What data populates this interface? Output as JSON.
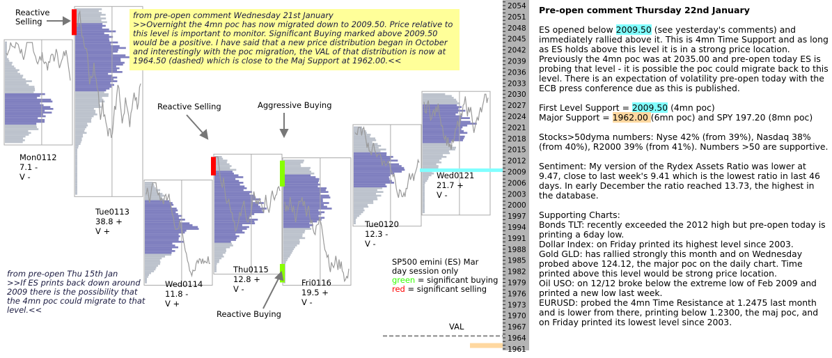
{
  "chart_data": {
    "type": "market-profile",
    "instrument_note": [
      "SP500 emini  (ES)  Mar",
      "day session only"
    ],
    "legend": [
      {
        "word": "green",
        "rest": " = significant buying",
        "color": "#33ff00"
      },
      {
        "word": "red",
        "rest": " = significant selling",
        "color": "#ff0000"
      }
    ],
    "y_axis": {
      "min": 1961,
      "max": 2054,
      "step": 3,
      "ticks": [
        2054,
        2051,
        2048,
        2045,
        2042,
        2039,
        2036,
        2033,
        2030,
        2027,
        2024,
        2021,
        2018,
        2015,
        2012,
        2009,
        2006,
        2003,
        2000,
        1997,
        1994,
        1991,
        1988,
        1985,
        1982,
        1979,
        1976,
        1973,
        1970,
        1967,
        1964,
        1961
      ]
    },
    "sessions": [
      {
        "day": "Mon0112",
        "range": "7.1 -",
        "value": "V -",
        "high": 2044,
        "low": 2017,
        "va_high": 2030,
        "va_low": 2022
      },
      {
        "day": "Tue0113",
        "range": "38.8 +",
        "value": "V +",
        "high": 2053,
        "low": 2003,
        "va_high": 2049,
        "va_low": 2031
      },
      {
        "day": "Wed0114",
        "range": "11.8 -",
        "value": "V +",
        "high": 2006,
        "low": 1979,
        "va_high": 2001,
        "va_low": 1987
      },
      {
        "day": "Thu0115",
        "range": "12.8 +",
        "value": "V -",
        "high": 2013,
        "low": 1982,
        "va_high": 2009,
        "va_low": 1990
      },
      {
        "day": "Fri0116",
        "range": "19.5 +",
        "value": "V -",
        "high": 2012,
        "low": 1979,
        "va_high": 2008,
        "va_low": 1994
      },
      {
        "day": "Tue0120",
        "range": "12.3 -",
        "value": "V -",
        "high": 2021,
        "low": 1995,
        "va_high": 2014,
        "va_low": 2005
      },
      {
        "day": "Wed0121",
        "range": "21.7 +",
        "value": "V -",
        "high": 2030,
        "low": 1998,
        "va_high": 2027,
        "va_low": 2017
      }
    ],
    "markers": [
      {
        "session": "Tue0113",
        "type": "selling",
        "color": "#ff0000",
        "from": 2046,
        "to": 2053
      },
      {
        "session": "Thu0115",
        "type": "selling",
        "color": "#ff0000",
        "from": 2008,
        "to": 2013
      },
      {
        "session": "Fri0116",
        "type": "buying",
        "color": "#88ff00",
        "from": 2005,
        "to": 2012
      },
      {
        "session": "Fri0116",
        "type": "buying",
        "color": "#88ff00",
        "from": 1979,
        "to": 1984
      }
    ],
    "levels": [
      {
        "label": "",
        "price": 2009.5,
        "color": "#80ffff",
        "style": "band"
      },
      {
        "label": "VAL",
        "price": 1964.5,
        "color": "#888888",
        "style": "dashed"
      },
      {
        "label": "",
        "price": 1962.0,
        "color": "#ffd8a0",
        "style": "band"
      }
    ],
    "annotations": [
      {
        "text": "Reactive Selling",
        "lines": [
          "Reactive",
          "Selling"
        ]
      },
      {
        "text": "Reactive Selling"
      },
      {
        "text": "Aggressive Buying"
      },
      {
        "text": "Reactive Buying"
      }
    ]
  },
  "notes": {
    "yellow": "from pre-open comment Wednesday 21st January\n>>Overnight the 4mn poc has now migrated down to 2009.50.  Price relative to this level is important to monitor.  Significant Buying marked above 2009.50 would be a positive. I have said that a new price distribution began in October and interestingly with the poc migration, the VAL of that distribution is now at 1964.50 (dashed) which is close to the Maj Support at 1962.00.<<",
    "left": "from pre-open Thu 15th Jan\n>>If ES prints back down around 2009 there is the possibility that the 4mn poc could migrate to that level.<<"
  },
  "panel": {
    "title": "Pre-open comment Thursday 22nd January",
    "p1_a": "ES opened below ",
    "p1_hl": "2009.50",
    "p1_b": " (see yesterday's comments) and immediately rallied above it.  This is 4mn Time Support and as long as ES holds above this level it is in a strong price location. Previously the 4mn poc was at 2035.00 and pre-open today ES is probing that level - it is possible the poc could migrate back to this level.  There is an expectation of volatility pre-open today with the ECB press conference due as this is published.",
    "s1_a": "First Level Support  = ",
    "s1_hl": "2009.50",
    "s1_b": " (4mn poc)",
    "s2_a": "Major Support = ",
    "s2_hl": "1962.00 ",
    "s2_b": " (6mn poc) and  SPY 197.20 (8mn poc)",
    "stocks": "Stocks>50dyma numbers: Nyse 42% (from 39%), Nasdaq 38% (from 40%), R2000 39% (from 41%).  Numbers >50 are supportive.",
    "sentiment": "Sentiment: My version of the Rydex Assets Ratio was lower at 9.47, close to last week's 9.41 which is the lowest ratio in last 46 days. In early December the ratio reached 13.73, the highest in the database.",
    "supporting": [
      "Supporting Charts:",
      "Bonds TLT: recently exceeded the 2012 high but pre-open today is printing a 6day low.",
      "Dollar Index: on Friday printed its highest level since 2003.",
      "Gold GLD: has rallied strongly this month and on Wednesday probed above 124.12, the major poc on the daily chart.  Time printed above this level would be strong price location.",
      "Oil USO: on 12/12 broke below the extreme low of Feb 2009 and printed a new low last week.",
      "EURUSD: probed the 4mn Time Resistance at 1.2475 last month and is lower from there, printing below 1.2300, the maj poc, and on Friday printed its lowest level since 2003."
    ]
  }
}
